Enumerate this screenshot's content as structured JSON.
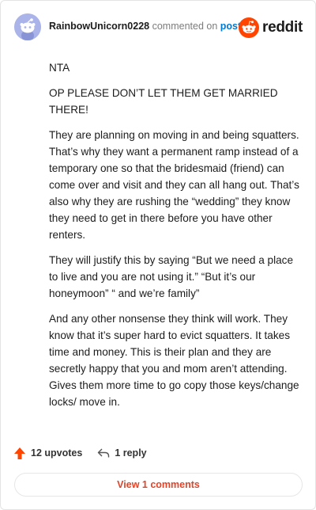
{
  "header": {
    "username": "RainbowUnicorn0228",
    "commented_text": "commented on",
    "post_link": "post",
    "brand": "reddit"
  },
  "comment": {
    "paragraphs": [
      "NTA",
      "OP PLEASE DON’T LET THEM GET MARRIED THERE!",
      "They are planning on moving in and being squatters. That’s why they want a permanent ramp instead of a temporary one so that the bridesmaid (friend) can come over and visit and they can all hang out. That’s also why they are rushing the “wedding” they know they need to get in there before you have other renters.",
      "They will justify this by saying “But we need a place to live and you are not using it.” “But it’s our honeymoon” “ and we’re family”",
      "And any other nonsense they think will work. They know that it’s super hard to evict squatters. It takes time and money. This is their plan and they are secretly happy that you and mom aren’t attending. Gives them more time to go copy those keys/change locks/ move in."
    ]
  },
  "actions": {
    "upvotes": "12 upvotes",
    "replies": "1 reply"
  },
  "footer": {
    "view_comments": "View 1 comments"
  },
  "colors": {
    "upvote_arrow": "#ff4500",
    "brand": "#ff4500",
    "link": "#0079d3",
    "view_button_text": "#e0452a",
    "avatar_bg": "#aab4e8"
  },
  "icons": {
    "upvote": "upvote-arrow-icon",
    "reply": "reply-arrow-icon",
    "logo": "reddit-snoo-icon",
    "avatar": "snoo-avatar-icon"
  }
}
